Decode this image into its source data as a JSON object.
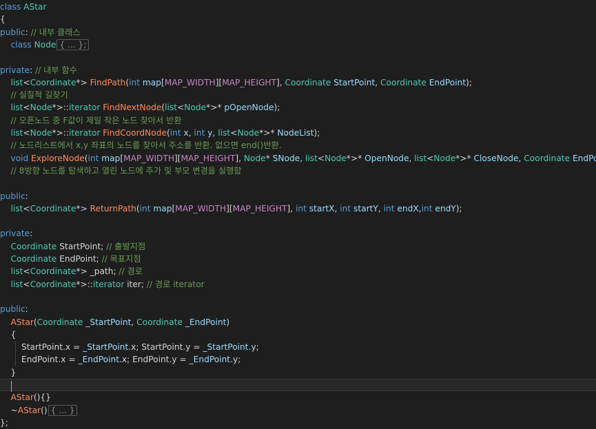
{
  "editor": {
    "lines": [
      [
        {
          "t": "class ",
          "c": "kw"
        },
        {
          "t": "AStar",
          "c": "type"
        }
      ],
      [
        {
          "t": "{",
          "c": "punc"
        }
      ],
      [
        {
          "t": "public",
          "c": "kw"
        },
        {
          "t": ": ",
          "c": "punc"
        },
        {
          "t": "// 내부 클래스",
          "c": "cmt"
        }
      ],
      [
        {
          "t": "    class ",
          "c": "kw"
        },
        {
          "t": "Node",
          "c": "type"
        },
        {
          "t": "{ ... };",
          "c": "fold"
        }
      ],
      [],
      [
        {
          "t": "private",
          "c": "kw"
        },
        {
          "t": ": ",
          "c": "punc"
        },
        {
          "t": "// 내부 함수",
          "c": "cmt"
        }
      ],
      [
        {
          "t": "    list",
          "c": "type"
        },
        {
          "t": "<",
          "c": "punc"
        },
        {
          "t": "Coordinate",
          "c": "type"
        },
        {
          "t": "*> ",
          "c": "punc"
        },
        {
          "t": "FindPath",
          "c": "fnr"
        },
        {
          "t": "(",
          "c": "punc"
        },
        {
          "t": "int ",
          "c": "kw"
        },
        {
          "t": "map",
          "c": "param"
        },
        {
          "t": "[",
          "c": "punc"
        },
        {
          "t": "MAP_WIDTH",
          "c": "macro"
        },
        {
          "t": "][",
          "c": "punc"
        },
        {
          "t": "MAP_HEIGHT",
          "c": "macro"
        },
        {
          "t": "], ",
          "c": "punc"
        },
        {
          "t": "Coordinate ",
          "c": "type"
        },
        {
          "t": "StartPoint",
          "c": "param"
        },
        {
          "t": ", ",
          "c": "punc"
        },
        {
          "t": "Coordinate ",
          "c": "type"
        },
        {
          "t": "EndPoint",
          "c": "param"
        },
        {
          "t": ");",
          "c": "punc"
        }
      ],
      [
        {
          "t": "    // 실질적 길찾기",
          "c": "cmt"
        }
      ],
      [
        {
          "t": "    list",
          "c": "type"
        },
        {
          "t": "<",
          "c": "punc"
        },
        {
          "t": "Node",
          "c": "type"
        },
        {
          "t": "*>::",
          "c": "punc"
        },
        {
          "t": "iterator ",
          "c": "type"
        },
        {
          "t": "FindNextNode",
          "c": "fnr"
        },
        {
          "t": "(",
          "c": "punc"
        },
        {
          "t": "list",
          "c": "type"
        },
        {
          "t": "<",
          "c": "punc"
        },
        {
          "t": "Node",
          "c": "type"
        },
        {
          "t": "*>* ",
          "c": "punc"
        },
        {
          "t": "pOpenNode",
          "c": "param"
        },
        {
          "t": ");",
          "c": "punc"
        }
      ],
      [
        {
          "t": "    // 오픈노드 중 F값이 제일 작은 노드 찾아서 반환",
          "c": "cmt"
        }
      ],
      [
        {
          "t": "    list",
          "c": "type"
        },
        {
          "t": "<",
          "c": "punc"
        },
        {
          "t": "Node",
          "c": "type"
        },
        {
          "t": "*>::",
          "c": "punc"
        },
        {
          "t": "iterator ",
          "c": "type"
        },
        {
          "t": "FindCoordNode",
          "c": "fnr"
        },
        {
          "t": "(",
          "c": "punc"
        },
        {
          "t": "int ",
          "c": "kw"
        },
        {
          "t": "x",
          "c": "param"
        },
        {
          "t": ", ",
          "c": "punc"
        },
        {
          "t": "int ",
          "c": "kw"
        },
        {
          "t": "y",
          "c": "param"
        },
        {
          "t": ", ",
          "c": "punc"
        },
        {
          "t": "list",
          "c": "type"
        },
        {
          "t": "<",
          "c": "punc"
        },
        {
          "t": "Node",
          "c": "type"
        },
        {
          "t": "*>* ",
          "c": "punc"
        },
        {
          "t": "NodeList",
          "c": "param"
        },
        {
          "t": ");",
          "c": "punc"
        }
      ],
      [
        {
          "t": "    // 노드리스트에서 x,y 좌표의 노드를 찾아서 주소를 반환. 없으면 end()반환.",
          "c": "cmt"
        }
      ],
      [
        {
          "t": "    void ",
          "c": "kw"
        },
        {
          "t": "ExploreNode",
          "c": "fnr"
        },
        {
          "t": "(",
          "c": "punc"
        },
        {
          "t": "int ",
          "c": "kw"
        },
        {
          "t": "map",
          "c": "param"
        },
        {
          "t": "[",
          "c": "punc"
        },
        {
          "t": "MAP_WIDTH",
          "c": "macro"
        },
        {
          "t": "][",
          "c": "punc"
        },
        {
          "t": "MAP_HEIGHT",
          "c": "macro"
        },
        {
          "t": "], ",
          "c": "punc"
        },
        {
          "t": "Node",
          "c": "type"
        },
        {
          "t": "* ",
          "c": "punc"
        },
        {
          "t": "SNode",
          "c": "param"
        },
        {
          "t": ", ",
          "c": "punc"
        },
        {
          "t": "list",
          "c": "type"
        },
        {
          "t": "<",
          "c": "punc"
        },
        {
          "t": "Node",
          "c": "type"
        },
        {
          "t": "*>* ",
          "c": "punc"
        },
        {
          "t": "OpenNode",
          "c": "param"
        },
        {
          "t": ", ",
          "c": "punc"
        },
        {
          "t": "list",
          "c": "type"
        },
        {
          "t": "<",
          "c": "punc"
        },
        {
          "t": "Node",
          "c": "type"
        },
        {
          "t": "*>* ",
          "c": "punc"
        },
        {
          "t": "CloseNode",
          "c": "param"
        },
        {
          "t": ", ",
          "c": "punc"
        },
        {
          "t": "Coordinate ",
          "c": "type"
        },
        {
          "t": "EndPoint",
          "c": "param"
        },
        {
          "t": ");",
          "c": "punc"
        }
      ],
      [
        {
          "t": "    // 8방향 노드를 탐색하고 열린 노드에 추가 및 부모 변경을 실행함",
          "c": "cmt"
        }
      ],
      [],
      [
        {
          "t": "public",
          "c": "kw"
        },
        {
          "t": ":",
          "c": "punc"
        }
      ],
      [
        {
          "t": "    list",
          "c": "type"
        },
        {
          "t": "<",
          "c": "punc"
        },
        {
          "t": "Coordinate",
          "c": "type"
        },
        {
          "t": "*> ",
          "c": "punc"
        },
        {
          "t": "ReturnPath",
          "c": "fnr"
        },
        {
          "t": "(",
          "c": "punc"
        },
        {
          "t": "int ",
          "c": "kw"
        },
        {
          "t": "map",
          "c": "param"
        },
        {
          "t": "[",
          "c": "punc"
        },
        {
          "t": "MAP_WIDTH",
          "c": "macro"
        },
        {
          "t": "][",
          "c": "punc"
        },
        {
          "t": "MAP_HEIGHT",
          "c": "macro"
        },
        {
          "t": "], ",
          "c": "punc"
        },
        {
          "t": "int ",
          "c": "kw"
        },
        {
          "t": "startX",
          "c": "param"
        },
        {
          "t": ", ",
          "c": "punc"
        },
        {
          "t": "int ",
          "c": "kw"
        },
        {
          "t": "startY",
          "c": "param"
        },
        {
          "t": ", ",
          "c": "punc"
        },
        {
          "t": "int ",
          "c": "kw"
        },
        {
          "t": "endX",
          "c": "param"
        },
        {
          "t": ",",
          "c": "punc"
        },
        {
          "t": "int ",
          "c": "kw"
        },
        {
          "t": "endY",
          "c": "param"
        },
        {
          "t": ");",
          "c": "punc"
        }
      ],
      [],
      [
        {
          "t": "private",
          "c": "kw"
        },
        {
          "t": ":",
          "c": "punc"
        }
      ],
      [
        {
          "t": "    Coordinate ",
          "c": "type"
        },
        {
          "t": "StartPoint",
          "c": "mem"
        },
        {
          "t": "; ",
          "c": "punc"
        },
        {
          "t": "// 출발지점",
          "c": "cmt"
        }
      ],
      [
        {
          "t": "    Coordinate ",
          "c": "type"
        },
        {
          "t": "EndPoint",
          "c": "mem"
        },
        {
          "t": "; ",
          "c": "punc"
        },
        {
          "t": "// 목표지점",
          "c": "cmt"
        }
      ],
      [
        {
          "t": "    list",
          "c": "type"
        },
        {
          "t": "<",
          "c": "punc"
        },
        {
          "t": "Coordinate",
          "c": "type"
        },
        {
          "t": "*> ",
          "c": "punc"
        },
        {
          "t": "_path",
          "c": "mem"
        },
        {
          "t": "; ",
          "c": "punc"
        },
        {
          "t": "// 경로",
          "c": "cmt"
        }
      ],
      [
        {
          "t": "    list",
          "c": "type"
        },
        {
          "t": "<",
          "c": "punc"
        },
        {
          "t": "Coordinate",
          "c": "type"
        },
        {
          "t": "*>::",
          "c": "punc"
        },
        {
          "t": "iterator ",
          "c": "type"
        },
        {
          "t": "iter",
          "c": "mem"
        },
        {
          "t": "; ",
          "c": "punc"
        },
        {
          "t": "// 경로 iterator",
          "c": "cmt"
        }
      ],
      [],
      [
        {
          "t": "public",
          "c": "kw"
        },
        {
          "t": ":",
          "c": "punc"
        }
      ],
      [
        {
          "t": "    AStar",
          "c": "fnr"
        },
        {
          "t": "(",
          "c": "punc"
        },
        {
          "t": "Coordinate ",
          "c": "type"
        },
        {
          "t": "_StartPoint",
          "c": "param"
        },
        {
          "t": ", ",
          "c": "punc"
        },
        {
          "t": "Coordinate ",
          "c": "type"
        },
        {
          "t": "_EndPoint",
          "c": "param"
        },
        {
          "t": ")",
          "c": "punc"
        }
      ],
      [
        {
          "t": "    {",
          "c": "punc"
        }
      ],
      [
        {
          "t": "        StartPoint",
          "c": "mem"
        },
        {
          "t": ".",
          "c": "punc"
        },
        {
          "t": "x",
          "c": "mem"
        },
        {
          "t": " = ",
          "c": "punc"
        },
        {
          "t": "_StartPoint",
          "c": "param"
        },
        {
          "t": ".",
          "c": "punc"
        },
        {
          "t": "x",
          "c": "mem"
        },
        {
          "t": "; ",
          "c": "punc"
        },
        {
          "t": "StartPoint",
          "c": "mem"
        },
        {
          "t": ".",
          "c": "punc"
        },
        {
          "t": "y",
          "c": "mem"
        },
        {
          "t": " = ",
          "c": "punc"
        },
        {
          "t": "_StartPoint",
          "c": "param"
        },
        {
          "t": ".",
          "c": "punc"
        },
        {
          "t": "y",
          "c": "mem"
        },
        {
          "t": ";",
          "c": "punc"
        }
      ],
      [
        {
          "t": "        EndPoint",
          "c": "mem"
        },
        {
          "t": ".",
          "c": "punc"
        },
        {
          "t": "x",
          "c": "mem"
        },
        {
          "t": " = ",
          "c": "punc"
        },
        {
          "t": "_EndPoint",
          "c": "param"
        },
        {
          "t": ".",
          "c": "punc"
        },
        {
          "t": "x",
          "c": "mem"
        },
        {
          "t": "; ",
          "c": "punc"
        },
        {
          "t": "EndPoint",
          "c": "mem"
        },
        {
          "t": ".",
          "c": "punc"
        },
        {
          "t": "y",
          "c": "mem"
        },
        {
          "t": " = ",
          "c": "punc"
        },
        {
          "t": "_EndPoint",
          "c": "param"
        },
        {
          "t": ".",
          "c": "punc"
        },
        {
          "t": "y",
          "c": "mem"
        },
        {
          "t": ";",
          "c": "punc"
        }
      ],
      [
        {
          "t": "    }",
          "c": "punc"
        }
      ],
      [
        {
          "t": "    ",
          "c": "punc"
        },
        {
          "t": "",
          "c": "caret"
        }
      ],
      [
        {
          "t": "    AStar",
          "c": "fnr"
        },
        {
          "t": "(){}",
          "c": "punc"
        }
      ],
      [
        {
          "t": "    ~",
          "c": "punc"
        },
        {
          "t": "AStar",
          "c": "fnr"
        },
        {
          "t": "()",
          "c": "punc"
        },
        {
          "t": "{ ... }",
          "c": "fold"
        }
      ],
      [
        {
          "t": "};",
          "c": "punc"
        }
      ]
    ],
    "current_line": 30
  }
}
